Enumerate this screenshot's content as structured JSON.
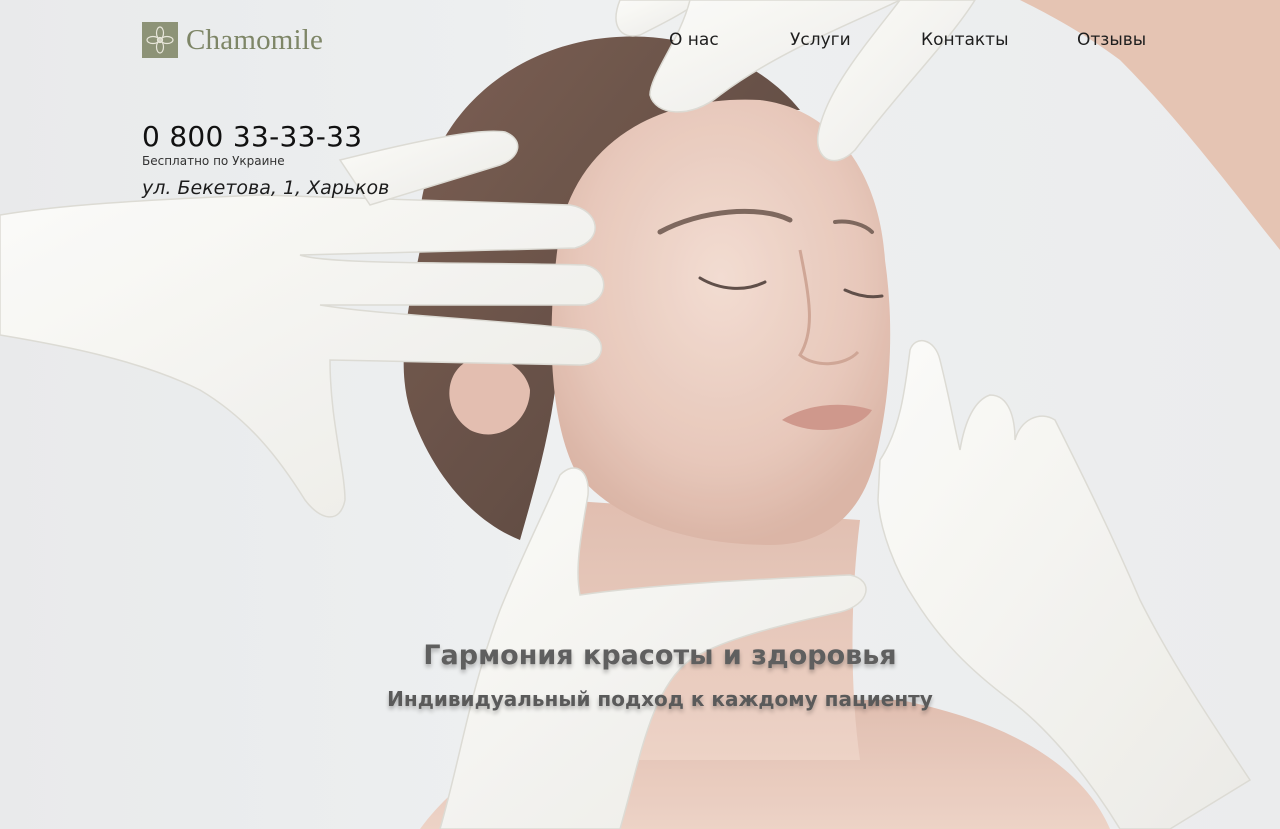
{
  "brand": {
    "name": "Chamomile",
    "accent_color": "#8d9377",
    "logo_icon": "chamomile-flower-icon"
  },
  "nav": {
    "items": [
      {
        "label": "О нас"
      },
      {
        "label": "Услуги"
      },
      {
        "label": "Контакты"
      },
      {
        "label": "Отзывы"
      }
    ]
  },
  "contact": {
    "phone": "0 800 33-33-33",
    "phone_note": "Бесплатно по Украине",
    "address": "ул. Бекетова, 1, Харьков"
  },
  "hero": {
    "title": "Гармония красоты и здоровья",
    "subtitle": "Индивидуальный подход к каждому пациенту",
    "image": "woman-face-gloved-hands-photo"
  }
}
